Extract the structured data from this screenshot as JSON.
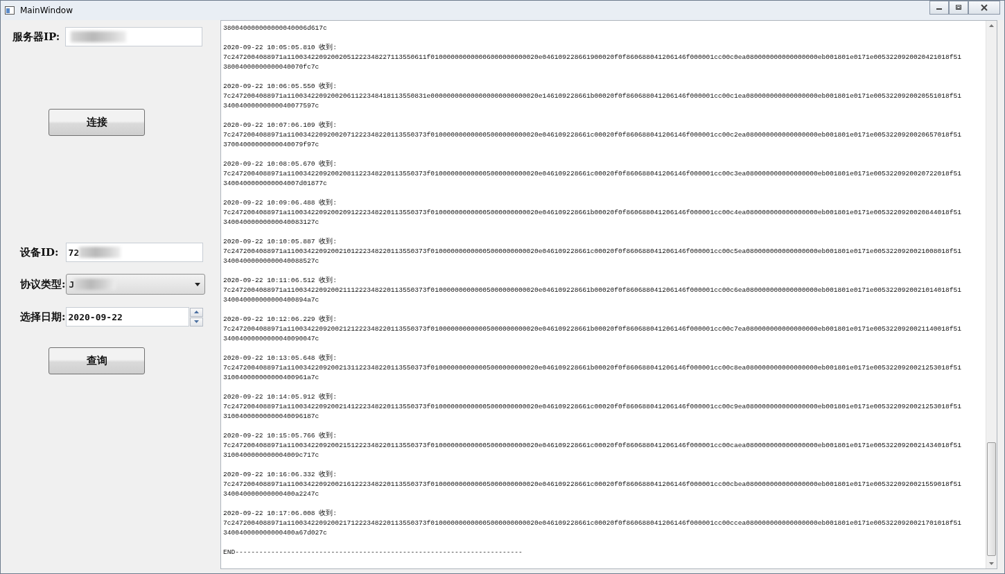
{
  "window": {
    "title": "MainWindow"
  },
  "form": {
    "server_ip": {
      "label": "服务器IP:",
      "value_obscured": true
    },
    "connect_button": "连接",
    "device_id": {
      "label": "设备ID:",
      "value": "72",
      "value_obscured": true
    },
    "protocol": {
      "label": "协议类型:",
      "value": "J",
      "value_obscured": true
    },
    "date": {
      "label": "选择日期:",
      "value": "2020-09-22"
    },
    "query_button": "查询"
  },
  "log": {
    "continued_tail": "380040000000000040006d617c",
    "records": [
      {
        "header": "2020-09-22 10:05:05.810 收到:",
        "hex": "7c2472004088971a11003422092002051222348227113550611f010000000000006000000000020e046109228661900020f0f860688041206146f000001cc00c0ea080000000000000000eb001801e0171e0053220920020421018f51",
        "tail": "38004000000000040070fc7c"
      },
      {
        "header": "2020-09-22 10:06:05.550 收到:",
        "hex": "7c2472004088971a11003422092002061122348418113550831e000000000000000000000000020e146109228661b00020f0f860688041206146f000001cc00c1ea080000000000000000eb001801e0171e0053220920020551018f51",
        "tail": "34004000000000040077597c"
      },
      {
        "header": "2020-09-22 10:07:06.109 收到:",
        "hex": "7c2472004088971a11003422092002071222348220113550373f010000000000005000000000020e046109228661c00020f0f860688041206146f000001cc00c2ea080000000000000000eb001801e0171e0053220920020657018f51",
        "tail": "37004000000000040079f97c"
      },
      {
        "header": "2020-09-22 10:08:05.670 收到:",
        "hex": "7c2472004088971a11003422092002081122348220113550373f010000000000005000000000020e046109228661c00020f0f860688041206146f000001cc00c3ea080000000000000000eb001801e0171e0053220920020722018f51",
        "tail": "3400400000000004007d01877c"
      },
      {
        "header": "2020-09-22 10:09:06.488 收到:",
        "hex": "7c2472004088971a11003422092002091222348220113550373f010000000000005000000000020e046109228661b00020f0f860688041206146f000001cc00c4ea080000000000000000eb001801e0171e0053220920020844018f51",
        "tail": "34004000000000040083127c"
      },
      {
        "header": "2020-09-22 10:10:05.887 收到:",
        "hex": "7c2472004088971a11003422092002101222348220113550373f010000000000005000000000020e046109228661c00020f0f860688041206146f000001cc00c5ea080000000000000000eb001801e0171e0053220920021008018f51",
        "tail": "34004000000000040088527c"
      },
      {
        "header": "2020-09-22 10:11:06.512 收到:",
        "hex": "7c2472004088971a11003422092002111222348220113550373f010000000000005000000000020e046109228661b00020f0f860688041206146f000001cc00c6ea080000000000000000eb001801e0171e0053220920021014018f51",
        "tail": "340040000000000400894a7c"
      },
      {
        "header": "2020-09-22 10:12:06.229 收到:",
        "hex": "7c2472004088971a11003422092002121222348220113550373f010000000000005000000000020e046109228661b00020f0f860688041206146f000001cc00c7ea080000000000000000eb001801e0171e0053220920021140018f51",
        "tail": "34004000000000040090047c"
      },
      {
        "header": "2020-09-22 10:13:05.648 收到:",
        "hex": "7c2472004088971a11003422092002131122348220113550373f010000000000005000000000020e046109228661b00020f0f860688041206146f000001cc00c8ea080000000000000000eb001801e0171e0053220920021253018f51",
        "tail": "310040000000000400961a7c"
      },
      {
        "header": "2020-09-22 10:14:05.912 收到:",
        "hex": "7c2472004088971a11003422092002141222348220113550373f010000000000005000000000020e046109228661c00020f0f860688041206146f000001cc00c9ea080000000000000000eb001801e0171e0053220920021253018f51",
        "tail": "31004000000000040096187c"
      },
      {
        "header": "2020-09-22 10:15:05.766 收到:",
        "hex": "7c2472004088971a11003422092002151222348220113550373f010000000000005000000000020e046109228661c00020f0f860688041206146f000001cc00caea080000000000000000eb001801e0171e0053220920021434018f51",
        "tail": "3100400000000004009c717c"
      },
      {
        "header": "2020-09-22 10:16:06.332 收到:",
        "hex": "7c2472004088971a11003422092002161222348220113550373f010000000000005000000000020e046109228661c00020f0f860688041206146f000001cc00cbea080000000000000000eb001801e0171e0053220920021559018f51",
        "tail": "340040000000000400a2247c"
      },
      {
        "header": "2020-09-22 10:17:06.008 收到:",
        "hex": "7c2472004088971a11003422092002171222348220113550373f010000000000005000000000020e046109228661c00020f0f860688041206146f000001cc00ccea080000000000000000eb001801e0171e0053220920021701018f51",
        "tail": "340040000000000400a67d027c"
      }
    ],
    "end_line": "END------------------------------------------------------------------------"
  }
}
